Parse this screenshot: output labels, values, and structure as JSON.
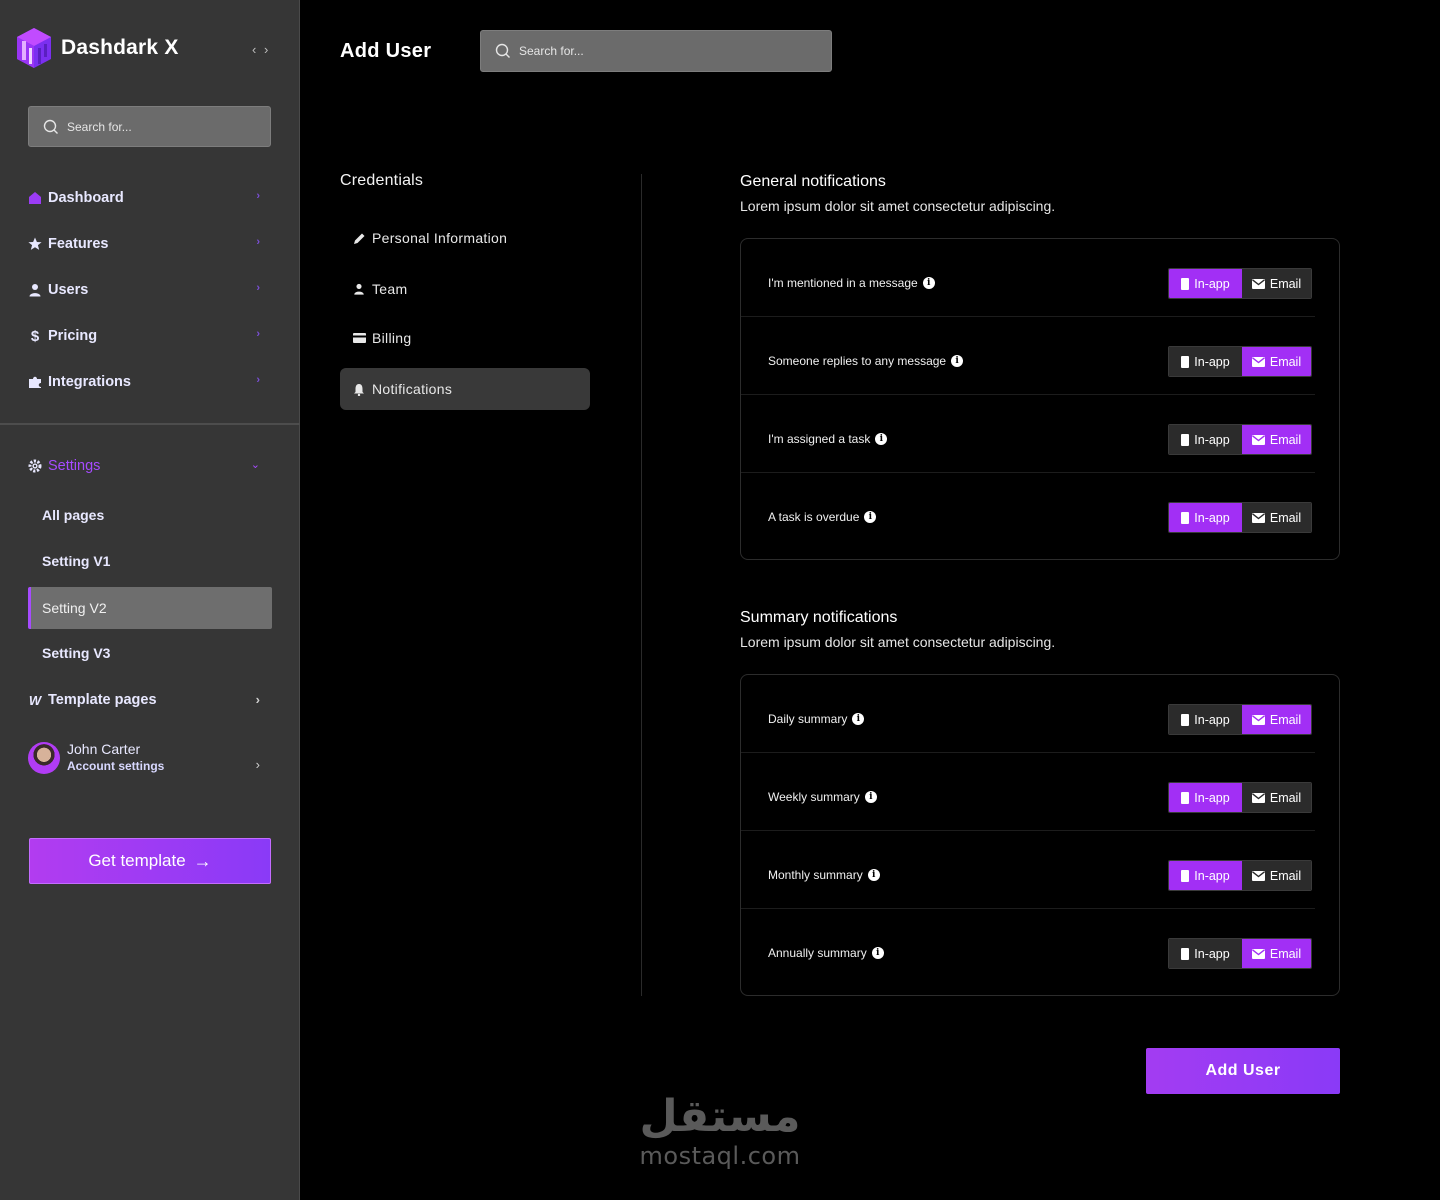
{
  "sidebar": {
    "brand": "Dashdark X",
    "collapse_toggle": "‹ ›",
    "search": {
      "placeholder": "Search for..."
    },
    "nav": [
      {
        "label": "Dashboard",
        "icon": "home-icon"
      },
      {
        "label": "Features",
        "icon": "star-icon"
      },
      {
        "label": "Users",
        "icon": "user-icon"
      },
      {
        "label": "Pricing",
        "icon": "dollar-icon"
      },
      {
        "label": "Integrations",
        "icon": "puzzle-icon"
      }
    ],
    "settings": {
      "label": "Settings",
      "icon": "gear-icon",
      "items": [
        {
          "label": "All pages",
          "active": false
        },
        {
          "label": "Setting V1",
          "active": false
        },
        {
          "label": "Setting V2",
          "active": true
        },
        {
          "label": "Setting V3",
          "active": false
        }
      ]
    },
    "template_pages": {
      "label": "Template pages",
      "icon": "w-icon"
    },
    "account": {
      "name": "John Carter",
      "subtitle": "Account settings"
    },
    "cta": {
      "label": "Get template",
      "icon": "arrow-right-icon"
    }
  },
  "header": {
    "title": "Add User",
    "search": {
      "placeholder": "Search for..."
    }
  },
  "subnav": {
    "title": "Credentials",
    "items": [
      {
        "label": "Personal Information",
        "icon": "pencil-icon",
        "active": false
      },
      {
        "label": "Team",
        "icon": "user-icon",
        "active": false
      },
      {
        "label": "Billing",
        "icon": "card-icon",
        "active": false
      },
      {
        "label": "Notifications",
        "icon": "bell-icon",
        "active": true
      }
    ]
  },
  "general": {
    "title": "General notifications",
    "description": "Lorem ipsum dolor sit amet consectetur adipiscing.",
    "rows": [
      {
        "label": "I'm mentioned in a message",
        "selected": "in-app"
      },
      {
        "label": "Someone replies to any message",
        "selected": "email"
      },
      {
        "label": "I'm assigned a task",
        "selected": "email"
      },
      {
        "label": "A task is overdue",
        "selected": "in-app"
      }
    ]
  },
  "summary": {
    "title": "Summary notifications",
    "description": "Lorem ipsum dolor sit amet consectetur adipiscing.",
    "rows": [
      {
        "label": "Daily summary",
        "selected": "email"
      },
      {
        "label": "Weekly summary",
        "selected": "in-app"
      },
      {
        "label": "Monthly summary",
        "selected": "in-app"
      },
      {
        "label": "Annually summary",
        "selected": "email"
      }
    ]
  },
  "toggle_labels": {
    "in_app": "In-app",
    "email": "Email"
  },
  "actions": {
    "add_user": "Add User"
  },
  "watermark": {
    "arabic": "مستقل",
    "latin": "mostaql.com"
  },
  "colors": {
    "accent": "#a22ff5",
    "sidebar_bg": "#363636",
    "page_bg": "#000000"
  }
}
